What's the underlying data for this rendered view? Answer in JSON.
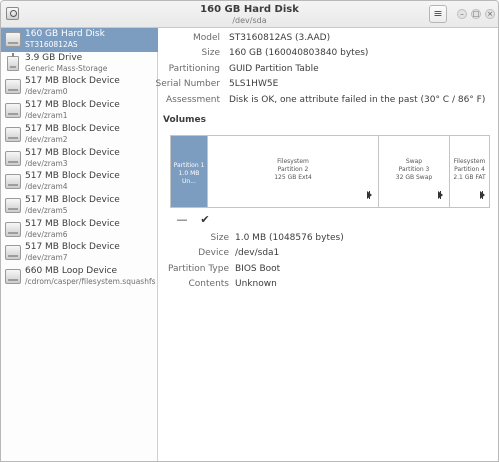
{
  "window": {
    "title": "160 GB Hard Disk",
    "subtitle": "/dev/sda",
    "menu_icon": "hamburger-menu-icon",
    "controls": [
      "minimize",
      "maximize",
      "close"
    ]
  },
  "sidebar": {
    "items": [
      {
        "name": "160 GB Hard Disk",
        "sub": "ST3160812AS",
        "icon": "hard-disk-icon",
        "selected": true
      },
      {
        "name": "3.9 GB Drive",
        "sub": "Generic Mass-Storage",
        "icon": "usb-drive-icon",
        "selected": false
      },
      {
        "name": "517 MB Block Device",
        "sub": "/dev/zram0",
        "icon": "block-device-icon",
        "selected": false
      },
      {
        "name": "517 MB Block Device",
        "sub": "/dev/zram1",
        "icon": "block-device-icon",
        "selected": false
      },
      {
        "name": "517 MB Block Device",
        "sub": "/dev/zram2",
        "icon": "block-device-icon",
        "selected": false
      },
      {
        "name": "517 MB Block Device",
        "sub": "/dev/zram3",
        "icon": "block-device-icon",
        "selected": false
      },
      {
        "name": "517 MB Block Device",
        "sub": "/dev/zram4",
        "icon": "block-device-icon",
        "selected": false
      },
      {
        "name": "517 MB Block Device",
        "sub": "/dev/zram5",
        "icon": "block-device-icon",
        "selected": false
      },
      {
        "name": "517 MB Block Device",
        "sub": "/dev/zram6",
        "icon": "block-device-icon",
        "selected": false
      },
      {
        "name": "517 MB Block Device",
        "sub": "/dev/zram7",
        "icon": "block-device-icon",
        "selected": false
      },
      {
        "name": "660 MB Loop Device",
        "sub": "/cdrom/casper/filesystem.squashfs",
        "icon": "loop-device-icon",
        "selected": false
      }
    ]
  },
  "drive_info": {
    "model_label": "Model",
    "model_value": "ST3160812AS (3.AAD)",
    "size_label": "Size",
    "size_value": "160 GB (160040803840 bytes)",
    "partitioning_label": "Partitioning",
    "partitioning_value": "GUID Partition Table",
    "serial_label": "Serial Number",
    "serial_value": "5LS1HW5E",
    "assessment_label": "Assessment",
    "assessment_value": "Disk is OK, one attribute failed in the past (30° C / 86° F)"
  },
  "volumes": {
    "heading": "Volumes",
    "partitions": [
      {
        "lines": [
          "Partition 1",
          "1.0 MB Un..."
        ],
        "selected": true
      },
      {
        "lines": [
          "Filesystem",
          "Partition 2",
          "125 GB Ext4"
        ],
        "selected": false
      },
      {
        "lines": [
          "Swap",
          "Partition 3",
          "32 GB Swap"
        ],
        "selected": false
      },
      {
        "lines": [
          "Filesystem",
          "Partition 4",
          "2.1 GB FAT"
        ],
        "selected": false
      }
    ],
    "tools": {
      "remove_icon": "minus-icon",
      "check_icon": "checkmark-icon"
    }
  },
  "partition_details": {
    "size_label": "Size",
    "size_value": "1.0 MB (1048576 bytes)",
    "device_label": "Device",
    "device_value": "/dev/sda1",
    "type_label": "Partition Type",
    "type_value": "BIOS Boot",
    "contents_label": "Contents",
    "contents_value": "Unknown"
  }
}
